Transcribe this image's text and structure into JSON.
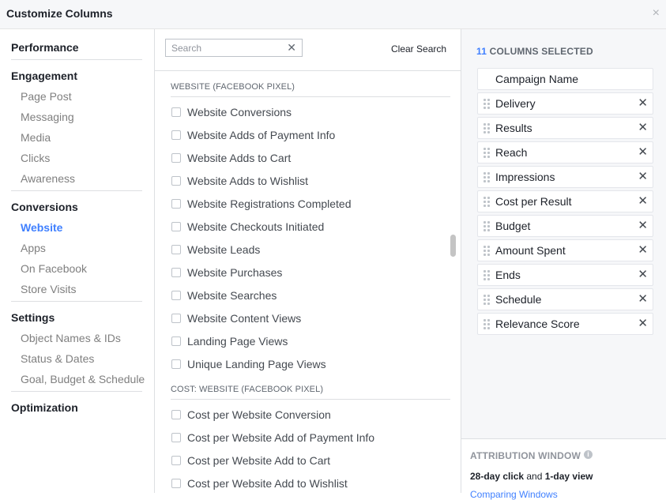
{
  "dialog": {
    "title": "Customize Columns",
    "close_glyph": "×"
  },
  "nav": {
    "groups": [
      {
        "label": "Performance",
        "items": []
      },
      {
        "label": "Engagement",
        "items": [
          "Page Post",
          "Messaging",
          "Media",
          "Clicks",
          "Awareness"
        ]
      },
      {
        "label": "Conversions",
        "items": [
          "Website",
          "Apps",
          "On Facebook",
          "Store Visits"
        ],
        "active": "Website"
      },
      {
        "label": "Settings",
        "items": [
          "Object Names & IDs",
          "Status & Dates",
          "Goal, Budget & Schedule"
        ]
      },
      {
        "label": "Optimization",
        "items": []
      }
    ]
  },
  "search": {
    "placeholder": "Search",
    "value": "",
    "clear_glyph": "✕",
    "clear_label": "Clear Search"
  },
  "sections": [
    {
      "heading": "WEBSITE (FACEBOOK PIXEL)",
      "items": [
        "Website Conversions",
        "Website Adds of Payment Info",
        "Website Adds to Cart",
        "Website Adds to Wishlist",
        "Website Registrations Completed",
        "Website Checkouts Initiated",
        "Website Leads",
        "Website Purchases",
        "Website Searches",
        "Website Content Views",
        "Landing Page Views",
        "Unique Landing Page Views"
      ]
    },
    {
      "heading": "COST: WEBSITE (FACEBOOK PIXEL)",
      "items": [
        "Cost per Website Conversion",
        "Cost per Website Add of Payment Info",
        "Cost per Website Add to Cart",
        "Cost per Website Add to Wishlist"
      ]
    }
  ],
  "selected": {
    "count": "11",
    "label": "COLUMNS SELECTED",
    "remove_glyph": "✕",
    "columns": [
      {
        "name": "Campaign Name",
        "locked": true
      },
      {
        "name": "Delivery"
      },
      {
        "name": "Results"
      },
      {
        "name": "Reach"
      },
      {
        "name": "Impressions"
      },
      {
        "name": "Cost per Result"
      },
      {
        "name": "Budget"
      },
      {
        "name": "Amount Spent"
      },
      {
        "name": "Ends"
      },
      {
        "name": "Schedule"
      },
      {
        "name": "Relevance Score"
      }
    ]
  },
  "attribution": {
    "heading": "ATTRIBUTION WINDOW",
    "info_glyph": "i",
    "click": "28-day click",
    "and": " and ",
    "view": "1-day view",
    "link": "Comparing Windows"
  },
  "colors": {
    "accent": "#4080ff",
    "muted": "#7f7f7f"
  },
  "icons": {
    "close": "close-icon",
    "clear": "clear-search-icon",
    "grip": "drag-handle-icon",
    "remove": "remove-icon",
    "info": "info-icon",
    "checkbox": "checkbox-icon"
  }
}
